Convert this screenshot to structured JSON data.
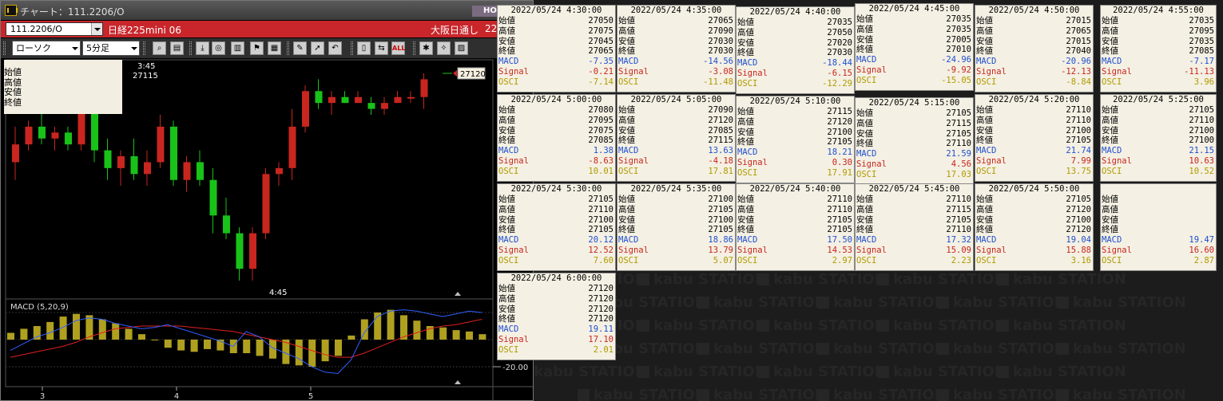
{
  "window": {
    "title": "チャート：111.2206/O",
    "ho_badge": "HO",
    "symbol_code": "111.2206/O",
    "instrument_name": "日経225mini 06",
    "market": "大阪日通し",
    "date_fragment": "22/"
  },
  "toolbar": {
    "chart_type": "ローソク",
    "interval": "5分足",
    "icons": [
      "zoom-icon",
      "layout-icon",
      "download-icon",
      "search-chart-icon",
      "bar-chart-icon",
      "flag-icon",
      "grid-icon",
      "draw-pen-icon",
      "pointer-icon",
      "undo-icon",
      "candle-width-icon",
      "shift-icon",
      "all-icon",
      "settings-icon",
      "wrench-icon",
      "color-palette-icon"
    ],
    "all_label": "ALL"
  },
  "ohlc_box": {
    "labels": [
      "始値",
      "高値",
      "安値",
      "終値"
    ]
  },
  "chart": {
    "price_tag": "27120",
    "annotation_time": "3:45",
    "annotation_price": "27115",
    "annotation_low_time": "4:45",
    "macd_label": "MACD (5,20,9)",
    "macd_tick": "-20.00",
    "x_ticks": [
      "3",
      "4",
      "5"
    ],
    "colors": {
      "up": "#c8261e",
      "down": "#19c219",
      "macd": "#2f5fff",
      "signal": "#e02020",
      "osci": "#b0a020"
    }
  },
  "chart_data": {
    "type": "candlestick",
    "candles": [
      {
        "o": 27050,
        "h": 27080,
        "l": 27035,
        "c": 27065,
        "up": true
      },
      {
        "o": 27065,
        "h": 27085,
        "l": 27060,
        "c": 27080,
        "up": true
      },
      {
        "o": 27080,
        "h": 27095,
        "l": 27065,
        "c": 27070,
        "up": false
      },
      {
        "o": 27070,
        "h": 27080,
        "l": 27060,
        "c": 27075,
        "up": true
      },
      {
        "o": 27075,
        "h": 27080,
        "l": 27060,
        "c": 27065,
        "up": false
      },
      {
        "o": 27065,
        "h": 27110,
        "l": 27060,
        "c": 27100,
        "up": true
      },
      {
        "o": 27100,
        "h": 27115,
        "l": 27050,
        "c": 27060,
        "up": false
      },
      {
        "o": 27060,
        "h": 27070,
        "l": 27035,
        "c": 27045,
        "up": false
      },
      {
        "o": 27045,
        "h": 27060,
        "l": 27030,
        "c": 27055,
        "up": true
      },
      {
        "o": 27055,
        "h": 27070,
        "l": 27035,
        "c": 27040,
        "up": false
      },
      {
        "o": 27040,
        "h": 27060,
        "l": 27030,
        "c": 27050,
        "up": true
      },
      {
        "o": 27050,
        "h": 27090,
        "l": 27045,
        "c": 27080,
        "up": true
      },
      {
        "o": 27080,
        "h": 27085,
        "l": 27030,
        "c": 27035,
        "up": false
      },
      {
        "o": 27035,
        "h": 27055,
        "l": 27025,
        "c": 27050,
        "up": true
      },
      {
        "o": 27050,
        "h": 27060,
        "l": 27030,
        "c": 27035,
        "up": false
      },
      {
        "o": 27035,
        "h": 27045,
        "l": 26990,
        "c": 27005,
        "up": false
      },
      {
        "o": 27005,
        "h": 27020,
        "l": 26985,
        "c": 26990,
        "up": false
      },
      {
        "o": 26990,
        "h": 26995,
        "l": 26950,
        "c": 26960,
        "up": false
      },
      {
        "o": 26960,
        "h": 26995,
        "l": 26950,
        "c": 26990,
        "up": true
      },
      {
        "o": 26990,
        "h": 27045,
        "l": 26985,
        "c": 27040,
        "up": true
      },
      {
        "o": 27040,
        "h": 27050,
        "l": 27030,
        "c": 27045,
        "up": true
      },
      {
        "o": 27045,
        "h": 27095,
        "l": 27035,
        "c": 27080,
        "up": true
      },
      {
        "o": 27080,
        "h": 27115,
        "l": 27075,
        "c": 27110,
        "up": true
      },
      {
        "o": 27110,
        "h": 27120,
        "l": 27095,
        "c": 27100,
        "up": false
      },
      {
        "o": 27100,
        "h": 27110,
        "l": 27090,
        "c": 27105,
        "up": true
      },
      {
        "o": 27105,
        "h": 27110,
        "l": 27100,
        "c": 27100,
        "up": false
      },
      {
        "o": 27100,
        "h": 27110,
        "l": 27100,
        "c": 27105,
        "up": true
      },
      {
        "o": 27100,
        "h": 27105,
        "l": 27090,
        "c": 27095,
        "up": false
      },
      {
        "o": 27095,
        "h": 27105,
        "l": 27090,
        "c": 27100,
        "up": true
      },
      {
        "o": 27100,
        "h": 27110,
        "l": 27100,
        "c": 27105,
        "up": true
      },
      {
        "o": 27105,
        "h": 27110,
        "l": 27100,
        "c": 27105,
        "up": true
      },
      {
        "o": 27105,
        "h": 27125,
        "l": 27095,
        "c": 27120,
        "up": true
      }
    ],
    "osci": [
      5,
      8,
      10,
      13,
      17,
      19,
      18,
      15,
      12,
      8,
      4,
      0,
      -6,
      -8,
      -9,
      -7,
      -8,
      -10,
      -10,
      -12,
      -14,
      -18,
      -19,
      -20,
      -16,
      -12,
      3,
      15,
      20,
      22,
      18,
      14,
      10,
      9,
      7,
      6,
      4
    ],
    "macd": [
      -8,
      -3,
      2,
      5,
      9,
      14,
      16,
      15,
      12,
      10,
      8,
      9,
      11,
      8,
      5,
      2,
      -1,
      -5,
      6,
      2,
      -6,
      -10,
      -14,
      -20,
      -24,
      -25,
      -15,
      5,
      17,
      21,
      22,
      21,
      19,
      17,
      19,
      21,
      20
    ],
    "signal": [
      -13,
      -11,
      -9,
      -7,
      -5,
      -2,
      2,
      5,
      8,
      9,
      10,
      10,
      10,
      10,
      9,
      8,
      7,
      6,
      4,
      2,
      0,
      -2,
      -5,
      -8,
      -11,
      -13,
      -13,
      -10,
      -6,
      -2,
      2,
      5,
      8,
      10,
      11,
      13,
      15
    ]
  },
  "detail_labels": {
    "open": "始値",
    "high": "高値",
    "low": "安値",
    "close": "終値",
    "macd": "MACD",
    "signal": "Signal",
    "osci": "OSCI"
  },
  "detail_boxes": [
    {
      "time": "2022/05/24 4:30:00",
      "open": "27050",
      "high": "27075",
      "low": "27045",
      "close": "27065",
      "macd": "-7.35",
      "signal": "-0.21",
      "osci": "-7.14"
    },
    {
      "time": "2022/05/24 4:35:00",
      "open": "27065",
      "high": "27090",
      "low": "27030",
      "close": "27030",
      "macd": "-14.56",
      "signal": "-3.08",
      "osci": "-11.48"
    },
    {
      "time": "2022/05/24 4:40:00",
      "open": "27035",
      "high": "27050",
      "low": "27020",
      "close": "27030",
      "macd": "-18.44",
      "signal": "-6.15",
      "osci": "-12.29"
    },
    {
      "time": "2022/05/24 4:45:00",
      "open": "27035",
      "high": "27035",
      "low": "27005",
      "close": "27010",
      "macd": "-24.96",
      "signal": "-9.92",
      "osci": "-15.05"
    },
    {
      "time": "2022/05/24 4:50:00",
      "open": "27015",
      "high": "27065",
      "low": "27015",
      "close": "27040",
      "macd": "-20.96",
      "signal": "-12.13",
      "osci": "-8.84"
    },
    {
      "time": "2022/05/24 4:55:00",
      "open": "27035",
      "high": "27095",
      "low": "27035",
      "close": "27085",
      "macd": "-7.17",
      "signal": "-11.13",
      "osci": "3.96"
    },
    {
      "time": "2022/05/24 5:00:00",
      "open": "27080",
      "high": "27095",
      "low": "27075",
      "close": "27085",
      "macd": "1.38",
      "signal": "-8.63",
      "osci": "10.01"
    },
    {
      "time": "2022/05/24 5:05:00",
      "open": "27090",
      "high": "27120",
      "low": "27085",
      "close": "27115",
      "macd": "13.63",
      "signal": "-4.18",
      "osci": "17.81"
    },
    {
      "time": "2022/05/24 5:10:00",
      "open": "27115",
      "high": "27120",
      "low": "27100",
      "close": "27105",
      "macd": "18.21",
      "signal": "0.30",
      "osci": "17.91"
    },
    {
      "time": "2022/05/24 5:15:00",
      "open": "27105",
      "high": "27115",
      "low": "27105",
      "close": "27110",
      "macd": "21.59",
      "signal": "4.56",
      "osci": "17.03"
    },
    {
      "time": "2022/05/24 5:20:00",
      "open": "27110",
      "high": "27110",
      "low": "27100",
      "close": "27105",
      "macd": "21.74",
      "signal": "7.99",
      "osci": "13.75"
    },
    {
      "time": "2022/05/24 5:25:00",
      "open": "27105",
      "high": "27110",
      "low": "27100",
      "close": "27100",
      "macd": "21.15",
      "signal": "10.63",
      "osci": "10.52"
    },
    {
      "time": "2022/05/24 5:30:00",
      "open": "27105",
      "high": "27110",
      "low": "27100",
      "close": "27105",
      "macd": "20.12",
      "signal": "12.52",
      "osci": "7.60"
    },
    {
      "time": "2022/05/24 5:35:00",
      "open": "27100",
      "high": "27105",
      "low": "27100",
      "close": "27105",
      "macd": "18.86",
      "signal": "13.79",
      "osci": "5.07"
    },
    {
      "time": "2022/05/24 5:40:00",
      "open": "27110",
      "high": "27110",
      "low": "27105",
      "close": "27105",
      "macd": "17.50",
      "signal": "14.53",
      "osci": "2.97"
    },
    {
      "time": "2022/05/24 5:45:00",
      "open": "27110",
      "high": "27115",
      "low": "27105",
      "close": "27110",
      "macd": "17.32",
      "signal": "15.09",
      "osci": "2.23"
    },
    {
      "time": "2022/05/24 5:50:00",
      "open": "27105",
      "high": "27120",
      "low": "27100",
      "close": "27120",
      "macd": "19.04",
      "signal": "15.88",
      "osci": "3.16"
    },
    {
      "time": "",
      "open": "",
      "high": "",
      "low": "",
      "close": "",
      "macd": "19.47",
      "signal": "16.60",
      "osci": "2.87"
    },
    {
      "time": "2022/05/24 6:00:00",
      "open": "27120",
      "high": "27120",
      "low": "27120",
      "close": "27120",
      "macd": "19.11",
      "signal": "17.10",
      "osci": "2.01"
    }
  ],
  "watermark_text": "kabu STATION"
}
